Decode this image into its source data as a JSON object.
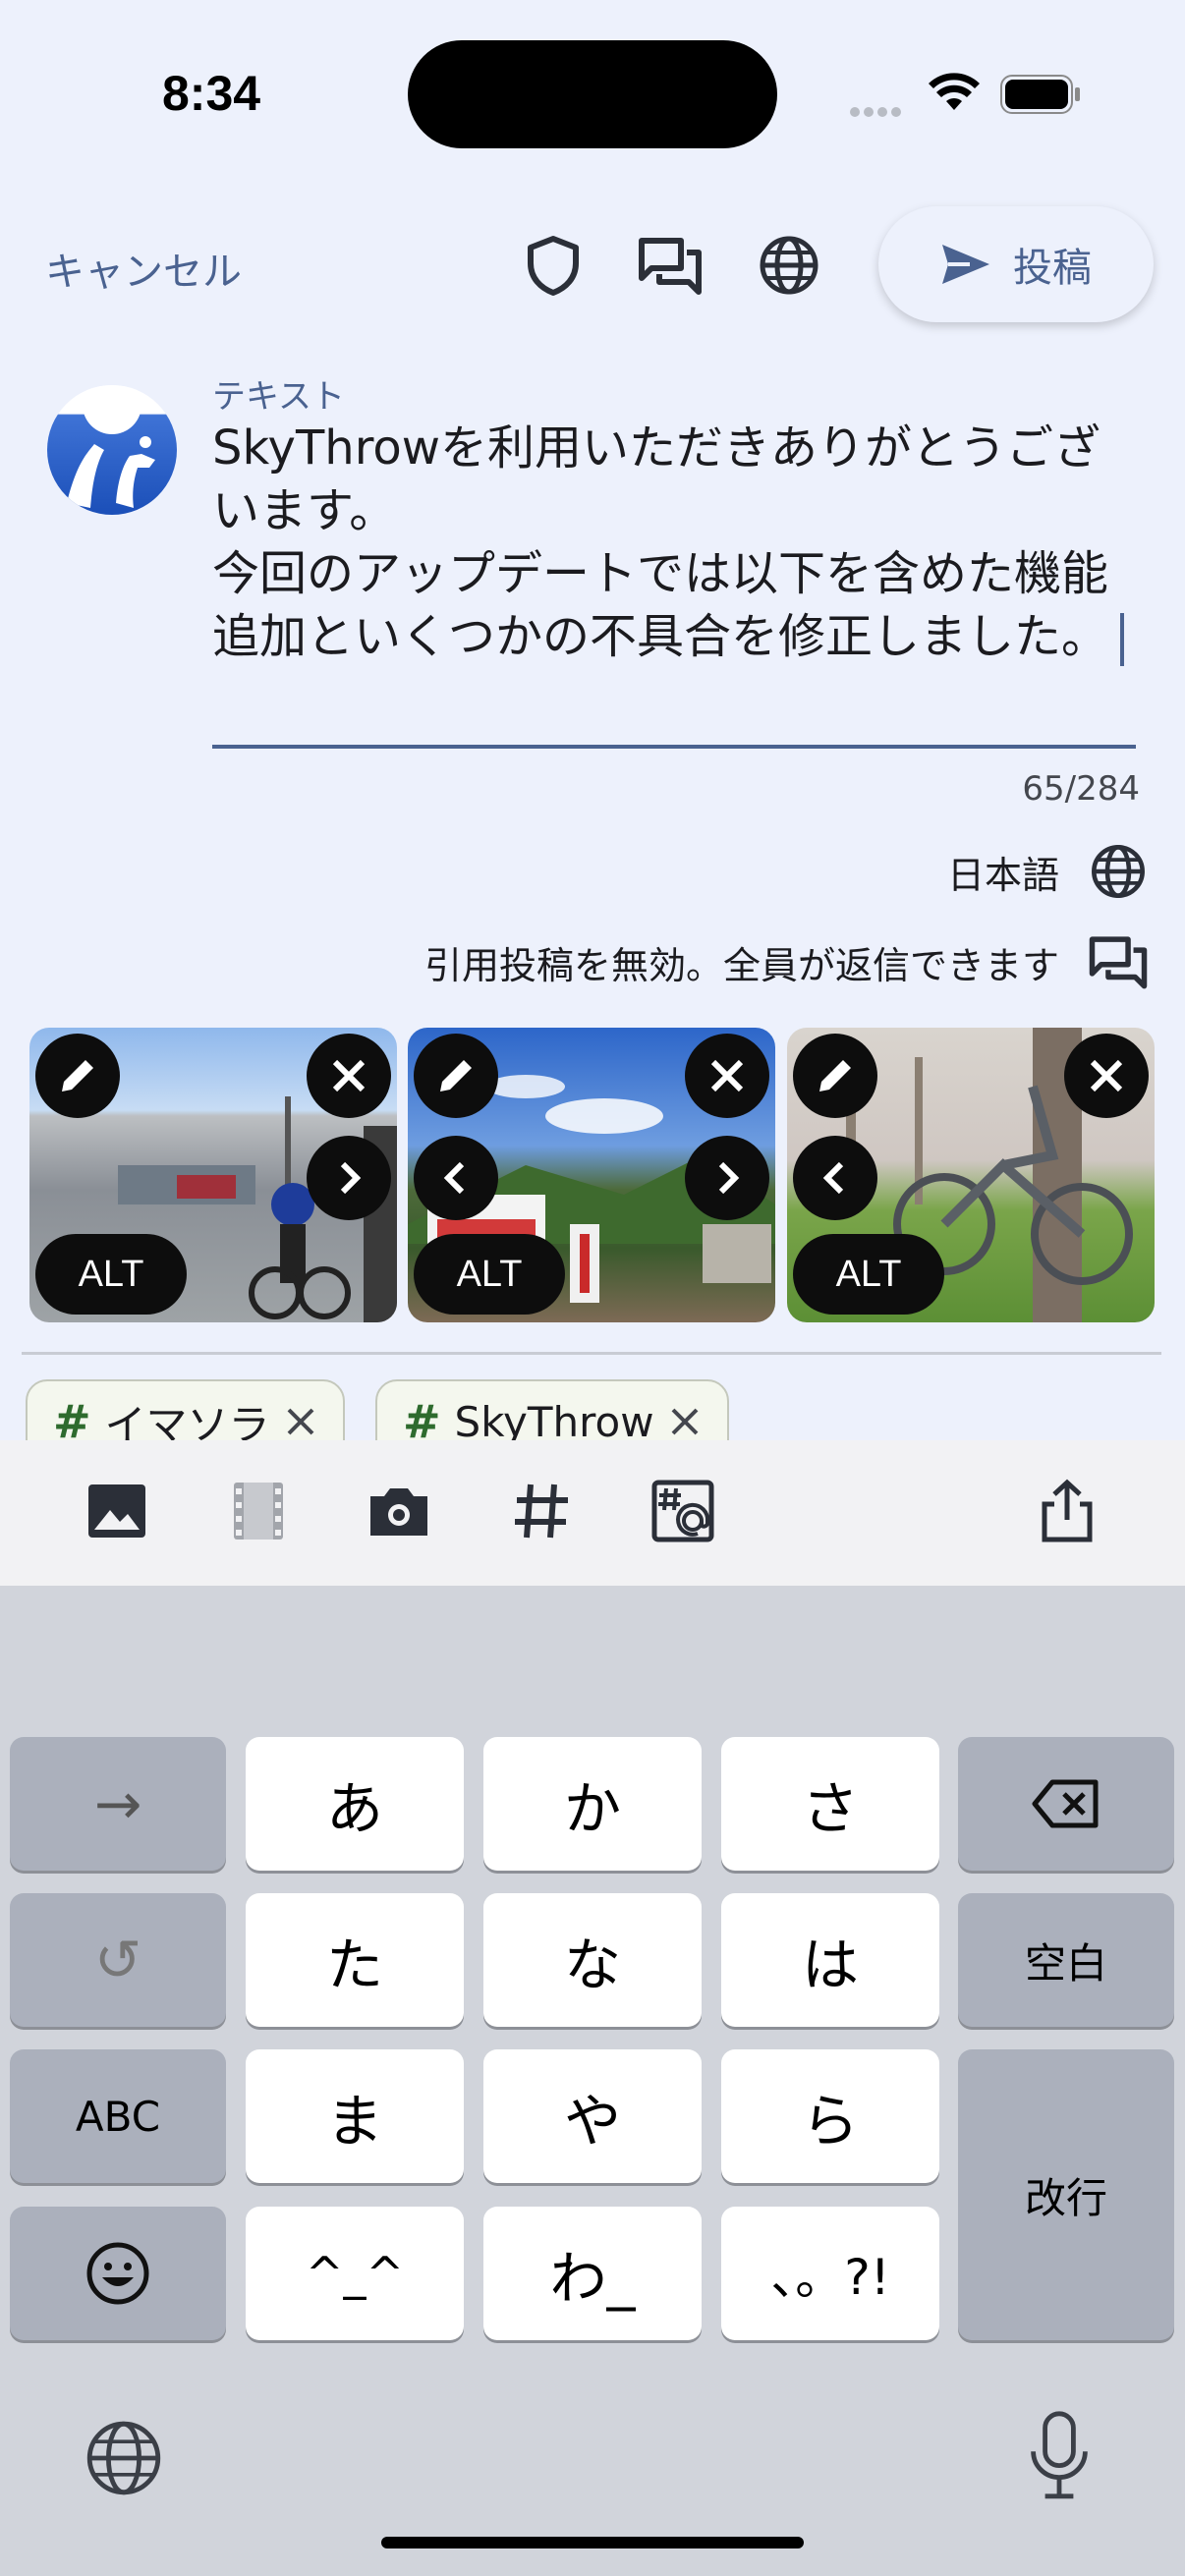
{
  "status_bar": {
    "time": "8:34"
  },
  "header": {
    "cancel_label": "キャンセル",
    "post_label": "投稿"
  },
  "compose": {
    "field_label": "テキスト",
    "text": "SkyThrowを利用いただきありがとうございます。\n今回のアップデートでは以下を含めた機能追加といくつかの不具合を修正しました。",
    "counter": "65/284",
    "language": "日本語",
    "reply_setting": "引用投稿を無効。全員が返信できます"
  },
  "images": [
    {
      "alt_label": "ALT",
      "has_prev": false,
      "has_next": true
    },
    {
      "alt_label": "ALT",
      "has_prev": true,
      "has_next": true
    },
    {
      "alt_label": "ALT",
      "has_prev": true,
      "has_next": false
    }
  ],
  "tags": [
    {
      "hash": "#",
      "label": "イマソラ"
    },
    {
      "hash": "#",
      "label": "SkyThrow"
    }
  ],
  "toolbar": {
    "icons": [
      "image-icon",
      "video-icon",
      "camera-icon",
      "hashtag-icon",
      "hashtag-mention-icon",
      "share-icon"
    ]
  },
  "keyboard": {
    "rows": [
      [
        "→",
        "あ",
        "か",
        "さ",
        "⌫"
      ],
      [
        "↺",
        "た",
        "な",
        "は",
        "空白"
      ],
      [
        "ABC",
        "ま",
        "や",
        "ら"
      ],
      [
        "☺",
        "^_^",
        "わ_",
        "、。?!"
      ]
    ],
    "return_label": "改行"
  },
  "colors": {
    "accent": "#4a6290",
    "background": "#edf1fc",
    "keyboard": "#d1d4db"
  }
}
